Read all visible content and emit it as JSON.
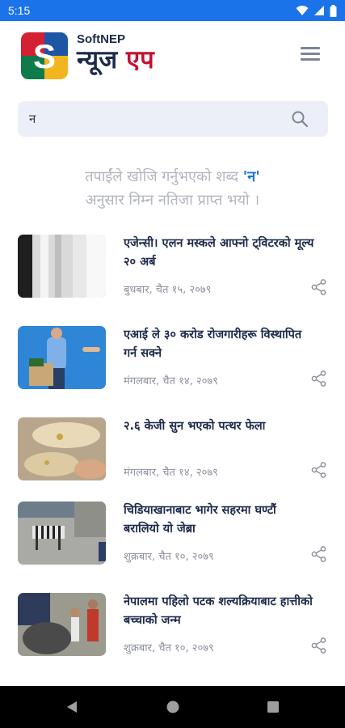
{
  "status_bar": {
    "time": "5:15",
    "icons": [
      "wifi-icon",
      "signal-icon",
      "battery-icon"
    ]
  },
  "header": {
    "logo_letter": "S",
    "brand_small": "SoftNEP",
    "brand_news": "न्यूज",
    "brand_app": "एप",
    "menu_icon": "hamburger-menu-icon"
  },
  "colors": {
    "status_bar": "#1a73e8",
    "brand_dark": "#1c2a4a",
    "brand_red": "#c4122f",
    "query_highlight": "#1a73e8",
    "logo_red": "#d42033",
    "logo_blue": "#1e56a6",
    "logo_green": "#0f7a4a",
    "logo_yellow": "#f2b51f"
  },
  "search": {
    "value": "न",
    "icon": "search-icon"
  },
  "result_message": {
    "prefix": "तपाईंले खोजि गर्नुभएको शब्द ",
    "query": "'न'",
    "suffix": "अनुसार निम्न नतिजा प्राप्त भयो ।"
  },
  "news": [
    {
      "title": "एजेन्सी। एलन मस्कले आफ्नो ट्विटरको मूल्य २० अर्ब",
      "date": "बुधबार, चैत १५, २०७९",
      "thumb": "waterfall-photo"
    },
    {
      "title": "एआई ले ३० करोड रोजगारीहरू विस्थापित गर्न सक्ने",
      "date": "मंगलबार, चैत १४, २०७९",
      "thumb": "man-with-box-photo"
    },
    {
      "title": "२.६ केजी सुन भएको पत्थर फेला",
      "date": "मंगलबार, चैत १४, २०७९",
      "thumb": "gold-rock-photo"
    },
    {
      "title": "चिडियाखानाबाट भागेर सहरमा घण्टौं बरालियो यो जेब्रा",
      "date": "शुक्रबार, चैत १०, २०७९",
      "thumb": "zebra-street-photo"
    },
    {
      "title": "नेपालमा पहिलो पटक शल्यक्रियाबाट हात्तीको बच्चाको जन्म",
      "date": "शुक्रबार, चैत १०, २०७९",
      "thumb": "baby-elephant-photo"
    }
  ],
  "nav_bar": {
    "icons": [
      "back-icon",
      "home-icon",
      "recents-icon"
    ]
  }
}
